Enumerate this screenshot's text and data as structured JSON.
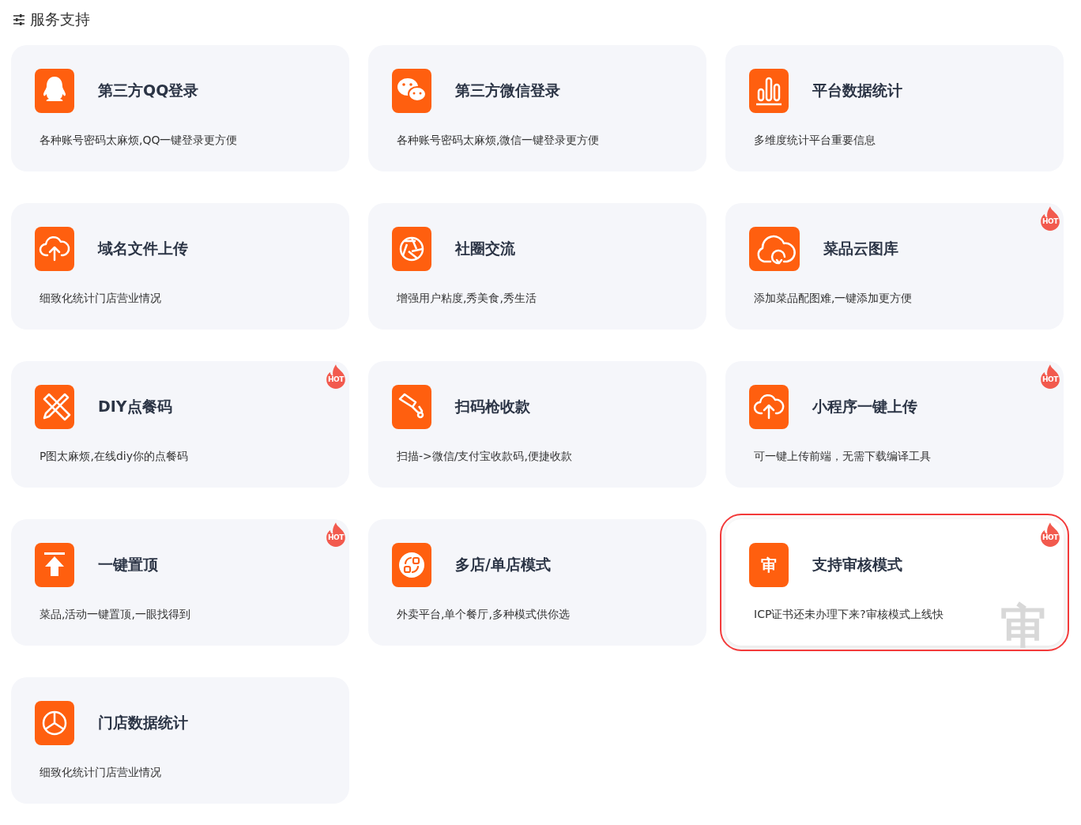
{
  "header": {
    "title": "服务支持"
  },
  "cards": [
    {
      "kind": "qq",
      "title": "第三方QQ登录",
      "description": "各种账号密码太麻烦,QQ一键登录更方便",
      "selected": false
    },
    {
      "kind": "wechat",
      "title": "第三方微信登录",
      "description": "各种账号密码太麻烦,微信一键登录更方便",
      "selected": false
    },
    {
      "kind": "chart",
      "title": "平台数据统计",
      "description": "多维度统计平台重要信息",
      "selected": false
    },
    {
      "kind": "upload",
      "title": "域名文件上传",
      "description": "细致化统计门店营业情况",
      "selected": false
    },
    {
      "kind": "aperture",
      "title": "社圈交流",
      "description": "增强用户粘度,秀美食,秀生活",
      "selected": false
    },
    {
      "kind": "cloud",
      "title": "菜品云图库",
      "description": "添加菜品配图难,一键添加更方便",
      "badge": "HOT",
      "selected": false
    },
    {
      "kind": "tools",
      "title": "DIY点餐码",
      "description": "P图太麻烦,在线diy你的点餐码",
      "badge": "HOT",
      "selected": false
    },
    {
      "kind": "scanner",
      "title": "扫码枪收款",
      "description": "扫描->微信/支付宝收款码,便捷收款",
      "selected": false
    },
    {
      "kind": "upload",
      "title": "小程序一键上传",
      "description": "可一键上传前端，无需下载编译工具",
      "badge": "HOT",
      "selected": false
    },
    {
      "kind": "top",
      "title": "一键置顶",
      "description": "菜品,活动一键置顶,一眼找得到",
      "badge": "HOT",
      "selected": false
    },
    {
      "kind": "swap",
      "title": "多店/单店模式",
      "description": "外卖平台,单个餐厅,多种模式供你选",
      "selected": false
    },
    {
      "kind": "text",
      "icon_text": "审",
      "title": "支持审核模式",
      "description": "ICP证书还未办理下来?审核模式上线快",
      "badge": "HOT",
      "watermark": "审",
      "selected": true
    },
    {
      "kind": "pie",
      "title": "门店数据统计",
      "description": "细致化统计门店营业情况",
      "selected": false
    }
  ]
}
